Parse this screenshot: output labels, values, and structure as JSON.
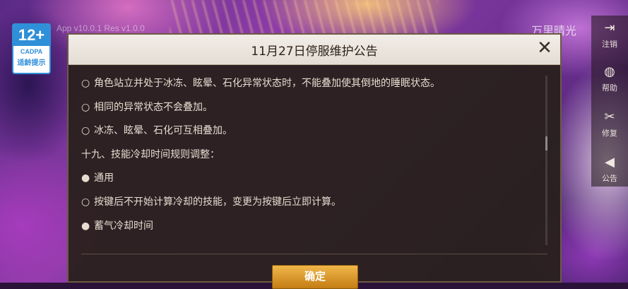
{
  "badge": {
    "age": "12+",
    "org": "CADPA",
    "tip": "适龄提示"
  },
  "app_version": "App v10.0.1 Res v1.0.0",
  "server_name": "万里晴光",
  "side_menu": [
    {
      "label": "注销",
      "icon": "logout-icon"
    },
    {
      "label": "帮助",
      "icon": "help-icon"
    },
    {
      "label": "修复",
      "icon": "wrench-icon"
    },
    {
      "label": "公告",
      "icon": "megaphone-icon"
    }
  ],
  "dialog": {
    "title": "11月27日停服维护公告",
    "close_label": "✕",
    "lines": [
      {
        "bullet": "○",
        "text": "角色站立并处于冰冻、眩晕、石化异常状态时，不能叠加使其倒地的睡眠状态。"
      },
      {
        "bullet": "○",
        "text": "相同的异常状态不会叠加。"
      },
      {
        "bullet": "○",
        "text": "冰冻、眩晕、石化可互相叠加。"
      },
      {
        "bullet": "",
        "text": "十九、技能冷却时间规则调整："
      },
      {
        "bullet": "●",
        "text": "通用"
      },
      {
        "bullet": "○",
        "text": "按键后不开始计算冷却的技能，变更为按键后立即计算。"
      },
      {
        "bullet": "●",
        "text": "蓄气冷却时间"
      }
    ],
    "confirm_label": "确定"
  }
}
